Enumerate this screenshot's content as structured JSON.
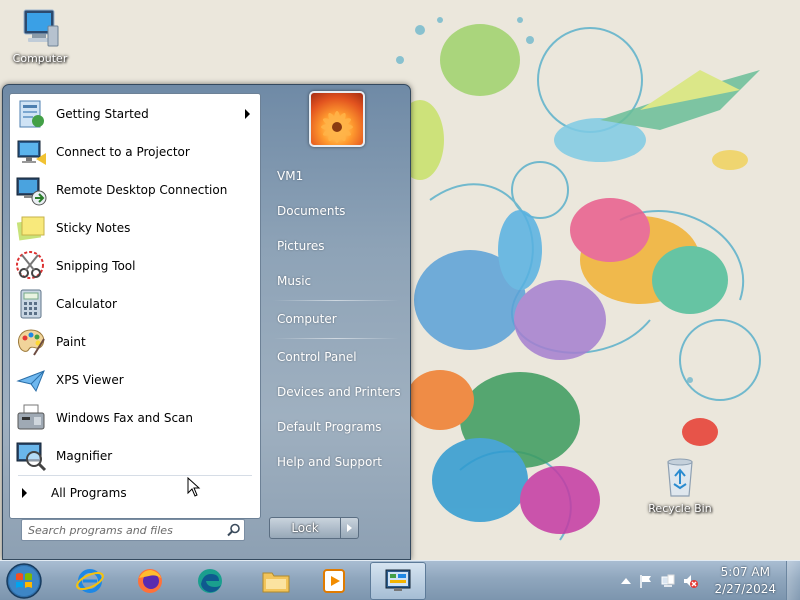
{
  "desktop": {
    "icons": [
      {
        "name": "Computer",
        "icon": "computer-icon"
      },
      {
        "name": "Recycle Bin",
        "icon": "recycle-bin-icon"
      }
    ]
  },
  "start_menu": {
    "programs": [
      {
        "label": "Getting Started",
        "icon": "getting-started-icon",
        "has_submenu": true
      },
      {
        "label": "Connect to a Projector",
        "icon": "projector-icon"
      },
      {
        "label": "Remote Desktop Connection",
        "icon": "remote-desktop-icon"
      },
      {
        "label": "Sticky Notes",
        "icon": "sticky-notes-icon"
      },
      {
        "label": "Snipping Tool",
        "icon": "scissors-icon"
      },
      {
        "label": "Calculator",
        "icon": "calculator-icon"
      },
      {
        "label": "Paint",
        "icon": "palette-icon"
      },
      {
        "label": "XPS Viewer",
        "icon": "xps-viewer-icon"
      },
      {
        "label": "Windows Fax and Scan",
        "icon": "fax-icon"
      },
      {
        "label": "Magnifier",
        "icon": "magnifier-icon"
      }
    ],
    "all_programs_label": "All Programs",
    "search_placeholder": "Search programs and files",
    "right_items": [
      {
        "label": "VM1"
      },
      {
        "label": "Documents"
      },
      {
        "label": "Pictures"
      },
      {
        "label": "Music"
      },
      {
        "label": "Computer"
      },
      {
        "label": "Control Panel"
      },
      {
        "label": "Devices and Printers"
      },
      {
        "label": "Default Programs"
      },
      {
        "label": "Help and Support"
      }
    ],
    "lock_label": "Lock"
  },
  "taskbar": {
    "pinned": [
      {
        "icon": "internet-explorer-icon"
      },
      {
        "icon": "firefox-icon"
      },
      {
        "icon": "edge-icon"
      },
      {
        "icon": "file-explorer-icon"
      },
      {
        "icon": "media-player-icon"
      },
      {
        "icon": "control-panel-icon",
        "active": true
      }
    ],
    "tray": {
      "time": "5:07 AM",
      "date": "2/27/2024"
    }
  },
  "colors": {
    "accent": "#1c63b7",
    "menu_frame": "#8ea3b7",
    "taskbar": "#8fa6bd"
  }
}
